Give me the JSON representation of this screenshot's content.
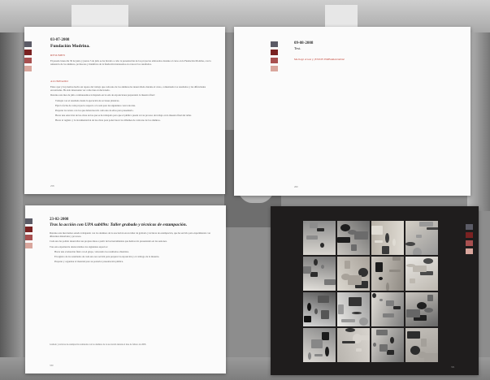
{
  "swatch_colors": [
    "#5b5b66",
    "#7a2222",
    "#a85050",
    "#d9a69d"
  ],
  "page1": {
    "date": "03-07-2008",
    "title": "Fundación Modrina.",
    "section_a": "RESUMEN",
    "intro": "El pasado lunes día 30 de junio y jueves 3 de julio se ha llevado a cabo la presentación de los proyectos elaborados durante el curso en la Fundación Modrina, con la asistencia de los alumnos, profesores y miembros de la fundación interesados en conocer los resultados.",
    "section_b": "ALUMNADO",
    "body1": "Entre ayer y hoy hemos hecho un repaso del trabajo que cada uno de los alumnos ha desarrollado durante el curso, comentando los resultados y las dificultades encontradas. Ha sido interesante ver como han evolucionado.",
    "body2": "Durante este mes de julio continuaremos trabajando en la sala de exposiciones preparando la muestra final:",
    "items": [
      "Trabajar con el resultado desde la ejecución de acciones plásticas.",
      "Fijar la fecha de cada proyecto respecto a la sala para las siguientes convocatorias.",
      "Preparar los textos con los que deben hacerlo cada uno de ellos para presentarlo.",
      "Hacer una selección de las obras en las que se ha trabajado para que el público pueda ver su proceso de trabajo en la muestra final del taller.",
      "Hacer el registro y la documentación de las obras para poder hacer los álbumes de cada uno de los alumnos."
    ],
    "page_number": "258"
  },
  "page2": {
    "date": "09-08-2008",
    "title": "Test.",
    "red_line": "Me llegó el test y ¡ESTOY EMBARAZADA!",
    "page_number": "260"
  },
  "page3": {
    "date": "23-02-2008",
    "title": "Tras la acción con UPA sub09n: Taller grabado y técnicas de estampación.",
    "body1": "Durante este mes hemos estado trabajando con los alumnos de la asociación en un taller de grabado y técnicas de estampación, que ha servido para experimentar con diferentes materiales y procesos.",
    "body2": "Cada uno ha podido desarrollar sus propias ideas a partir de las herramientas que hemos ido presentando en las sesiones.",
    "body3": "Tras esta experiencia destacaríamos los siguientes aspectos:",
    "items": [
      "Hacer una evaluación final con el grupo, valorando los resultados obtenidos.",
      "El registro de los resultados de cada uno nos servirá para preparar la exposición y el catálogo de la muestra.",
      "Preparar y organizar el material para su posterior presentación pública."
    ],
    "footnote": "Grabado y técnicas de estampación realizadas con los alumnos de la asociación durante el mes de febrero de 2008.",
    "page_number": "330"
  },
  "page4": {
    "page_number": "331"
  }
}
